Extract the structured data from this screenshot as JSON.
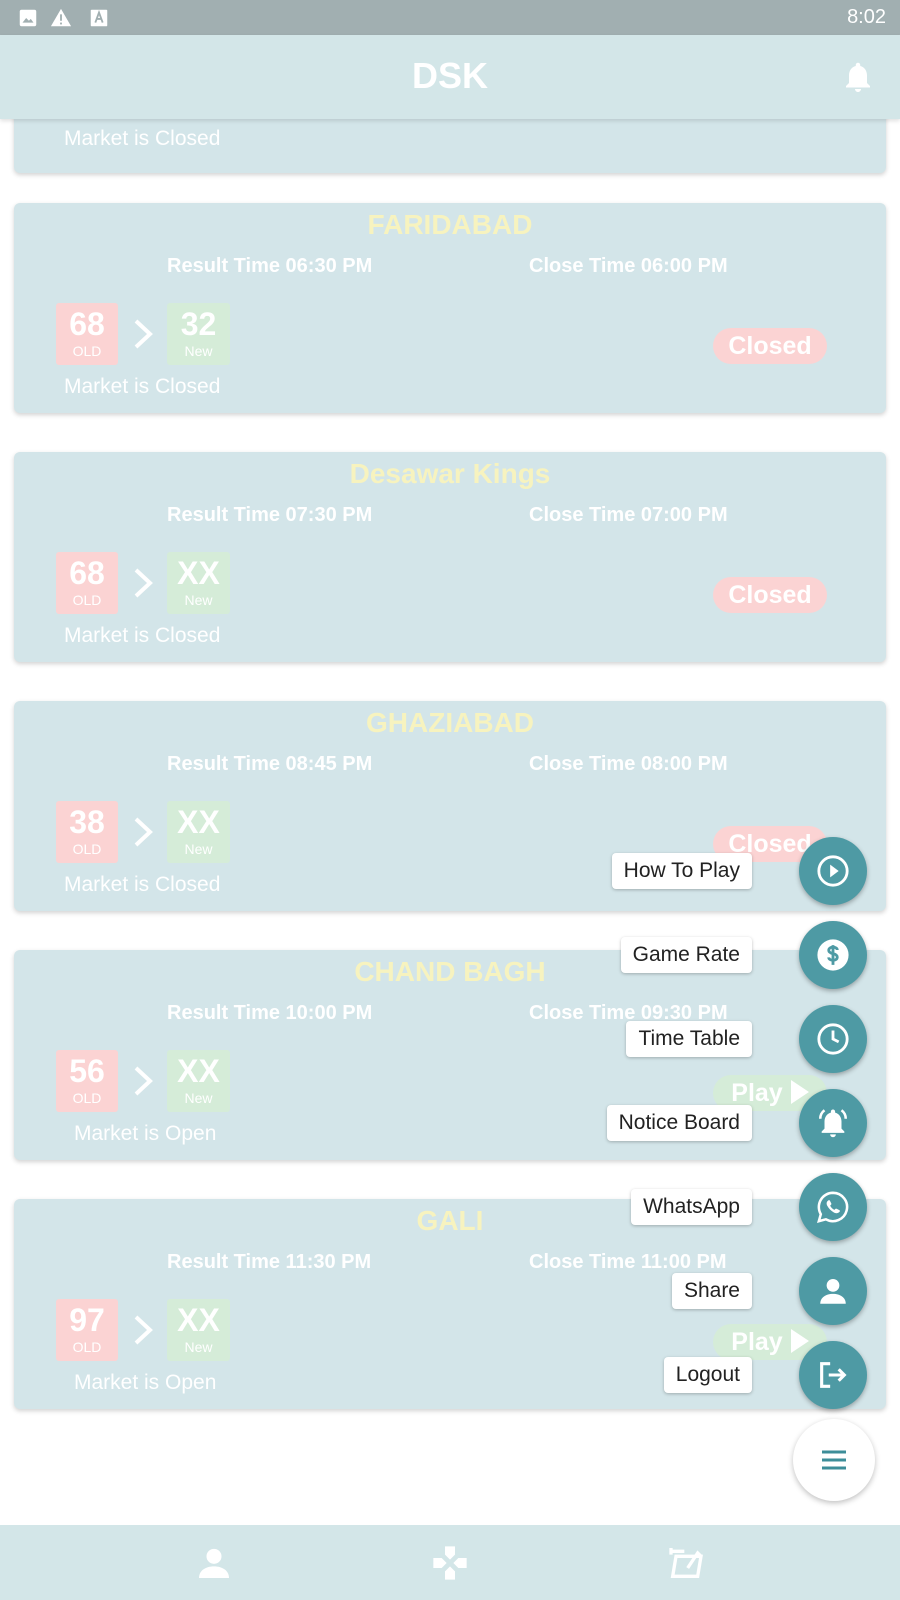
{
  "status_bar": {
    "time": "8:02",
    "icons": [
      "image-icon",
      "warning-icon",
      "font-icon"
    ]
  },
  "app_bar": {
    "title": "DSK",
    "right_icon": "bell-icon"
  },
  "partial_card": {
    "status": "Market is Closed"
  },
  "markets": [
    {
      "name": "FARIDABAD",
      "result_time": "Result Time 06:30 PM",
      "close_time": "Close Time 06:00 PM",
      "old_number": "68",
      "old_label": "OLD",
      "new_number": "32",
      "new_label": "New",
      "status": "Market is Closed",
      "action": "Closed"
    },
    {
      "name": "Desawar Kings",
      "result_time": "Result Time 07:30 PM",
      "close_time": "Close Time 07:00 PM",
      "old_number": "68",
      "old_label": "OLD",
      "new_number": "XX",
      "new_label": "New",
      "status": "Market is Closed",
      "action": "Closed"
    },
    {
      "name": "GHAZIABAD",
      "result_time": "Result Time 08:45 PM",
      "close_time": "Close Time 08:00 PM",
      "old_number": "38",
      "old_label": "OLD",
      "new_number": "XX",
      "new_label": "New",
      "status": "Market is Closed",
      "action": "Closed"
    },
    {
      "name": "CHAND BAGH",
      "result_time": "Result Time 10:00 PM",
      "close_time": "Close Time 09:30 PM",
      "old_number": "56",
      "old_label": "OLD",
      "new_number": "XX",
      "new_label": "New",
      "status": "Market is Open",
      "action": "Play"
    },
    {
      "name": "GALI",
      "result_time": "Result Time 11:30 PM",
      "close_time": "Close Time 11:00 PM",
      "old_number": "97",
      "old_label": "OLD",
      "new_number": "XX",
      "new_label": "New",
      "status": "Market is Open",
      "action": "Play"
    }
  ],
  "speed_dial": {
    "items": [
      {
        "label": "How To Play",
        "icon": "play-circle-icon"
      },
      {
        "label": "Game Rate",
        "icon": "dollar-icon"
      },
      {
        "label": "Time Table",
        "icon": "clock-icon"
      },
      {
        "label": "Notice Board",
        "icon": "bell-ring-icon"
      },
      {
        "label": "WhatsApp",
        "icon": "whatsapp-icon"
      },
      {
        "label": "Share",
        "icon": "person-icon"
      },
      {
        "label": "Logout",
        "icon": "logout-icon"
      }
    ],
    "toggle_icon": "menu-icon"
  },
  "bottom_nav": {
    "items": [
      "person-icon",
      "gamepad-icon",
      "passbook-icon"
    ]
  },
  "colors": {
    "app_bar": "#d3e6e8",
    "card": "#d3e5e9",
    "market_name": "#f7f3bf",
    "old_box": "#fbd3d3",
    "new_box": "#d5ecd8",
    "fab": "#4e9aa4"
  }
}
